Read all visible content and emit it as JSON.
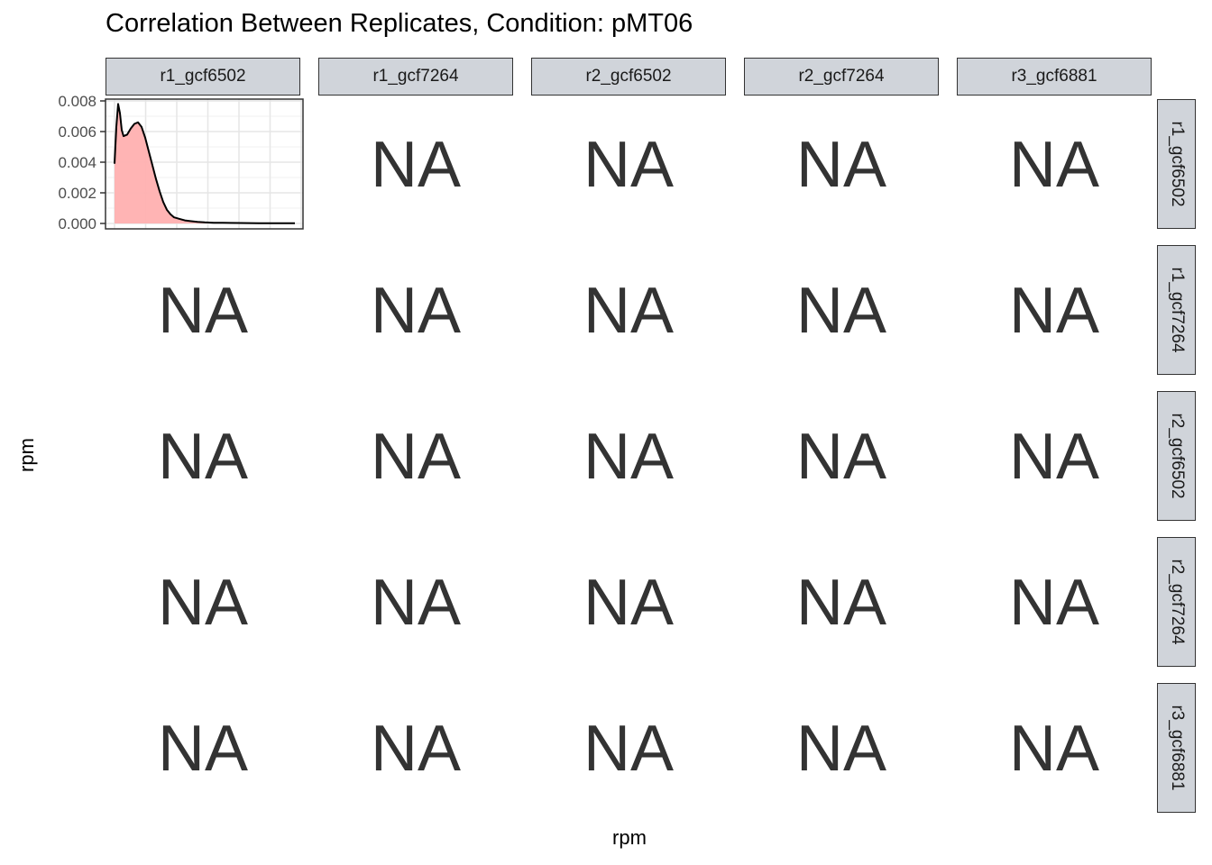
{
  "title": "Correlation Between Replicates, Condition: pMT06",
  "xlabel": "rpm",
  "ylabel": "rpm",
  "columns": [
    "r1_gcf6502",
    "r1_gcf7264",
    "r2_gcf6502",
    "r2_gcf7264",
    "r3_gcf6881"
  ],
  "rows": [
    "r1_gcf6502",
    "r1_gcf7264",
    "r2_gcf6502",
    "r2_gcf7264",
    "r3_gcf6881"
  ],
  "na_text": "NA",
  "colors": {
    "density_fill": "#ffb0b0",
    "density_line": "#000000",
    "strip_fill": "#d0d4da",
    "na_text": "#333333"
  },
  "chart_data": {
    "type": "area",
    "panel": "r1_gcf6502 × r1_gcf6502",
    "y_ticks": [
      "0.000",
      "0.002",
      "0.004",
      "0.006",
      "0.008"
    ],
    "ylim": [
      0,
      0.008
    ],
    "xlim": [
      0,
      1
    ],
    "grid": true,
    "x": [
      0.0,
      0.01,
      0.02,
      0.03,
      0.04,
      0.05,
      0.07,
      0.09,
      0.11,
      0.13,
      0.15,
      0.17,
      0.19,
      0.21,
      0.23,
      0.25,
      0.27,
      0.29,
      0.31,
      0.33,
      0.36,
      0.39,
      0.42,
      0.46,
      0.5,
      0.55,
      0.6,
      0.7,
      0.8,
      0.9,
      1.0
    ],
    "y": [
      0.0039,
      0.0063,
      0.0078,
      0.0072,
      0.0061,
      0.0057,
      0.0058,
      0.0062,
      0.0065,
      0.0066,
      0.0063,
      0.0056,
      0.0047,
      0.0038,
      0.0029,
      0.0021,
      0.0014,
      0.0009,
      0.0006,
      0.0004,
      0.0003,
      0.0002,
      0.00015,
      0.0001,
      7e-05,
      5e-05,
      4e-05,
      3e-05,
      2e-05,
      1e-05,
      1e-05
    ]
  }
}
